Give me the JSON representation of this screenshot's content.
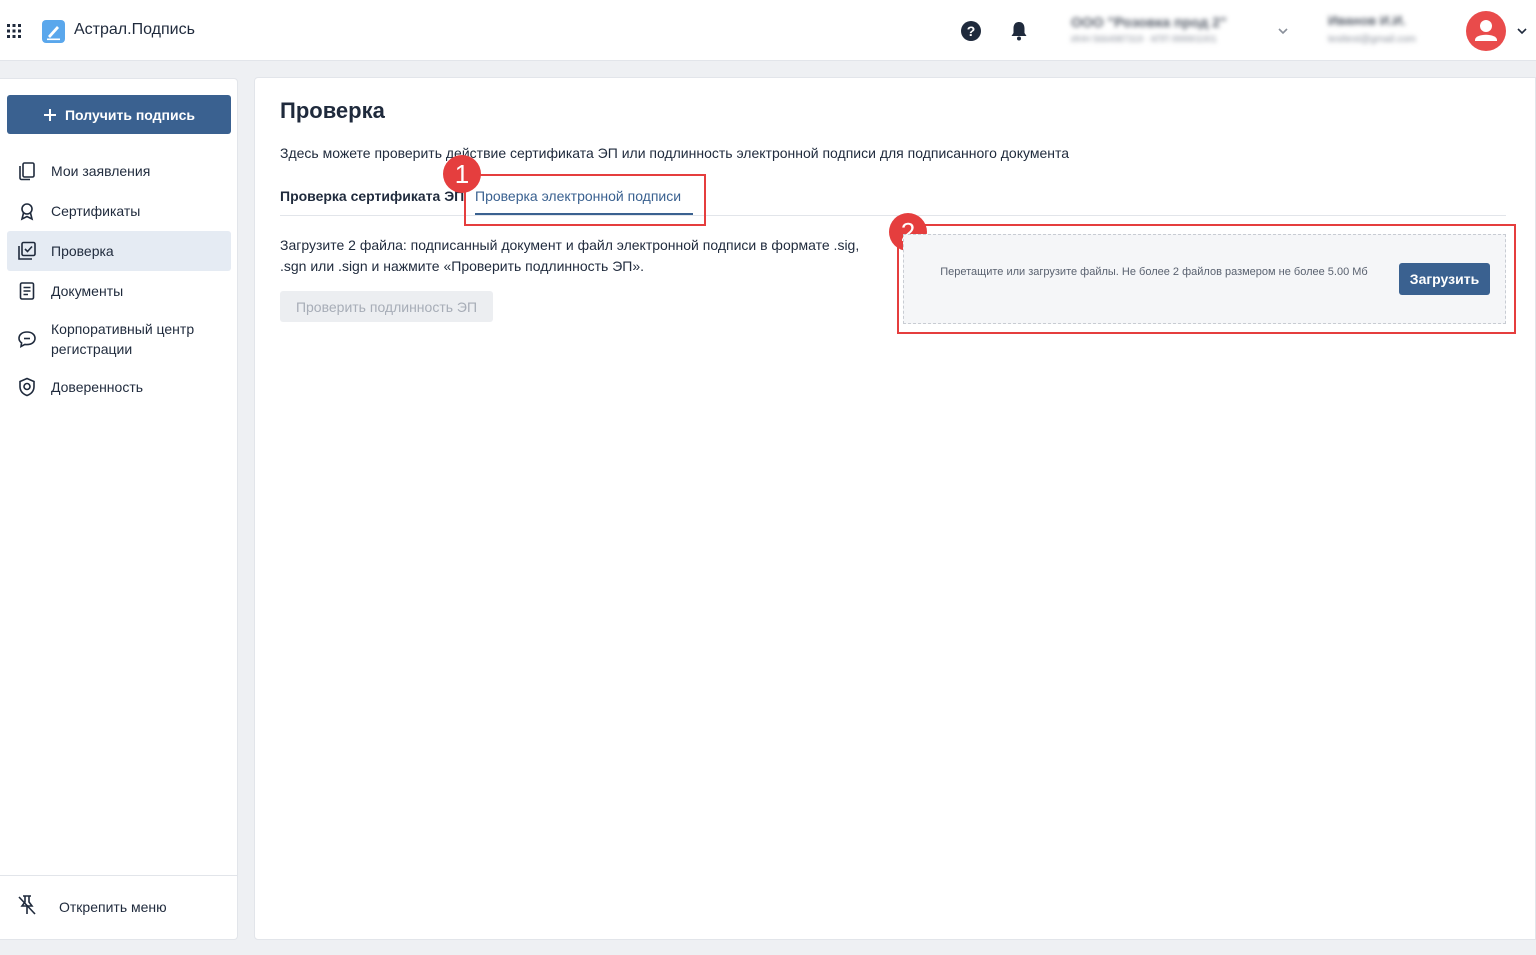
{
  "header": {
    "app_title": "Астрал.Подпись",
    "org_name": "ООО \"Розовка прод 2\"",
    "org_inn": "ИНН 5664987319 · КПП 999901001",
    "user_name": "Иванов И.И.",
    "user_email": "testtest@gmail.com"
  },
  "sidebar": {
    "get_sign_label": "Получить подпись",
    "items": [
      {
        "label": "Мои заявления"
      },
      {
        "label": "Сертификаты"
      },
      {
        "label": "Проверка"
      },
      {
        "label": "Документы"
      },
      {
        "label": "Корпоративный центр регистрации"
      },
      {
        "label": "Доверенность"
      }
    ],
    "unpin_label": "Открепить меню"
  },
  "main": {
    "title": "Проверка",
    "description": "Здесь можете проверить действие сертификата ЭП или подлинность электронной подписи для подписанного документа",
    "tabs": [
      {
        "label": "Проверка сертификата ЭП",
        "active": false
      },
      {
        "label": "Проверка электронной подписи",
        "active": true
      }
    ],
    "upload_instruction": "Загрузите 2 файла: подписанный документ и файл электронной подписи в формате .sig, .sgn или .sign и нажмите «Проверить подлинность ЭП».",
    "verify_button": "Проверить подлинность ЭП",
    "dropzone_text": "Перетащите или загрузите файлы. Не более 2 файлов размером не более 5.00 Мб",
    "upload_button": "Загрузить"
  },
  "annotations": [
    "1",
    "2"
  ],
  "colors": {
    "accent": "#3a6190",
    "highlight": "#e53e3e",
    "avatar": "#e94b4b"
  }
}
